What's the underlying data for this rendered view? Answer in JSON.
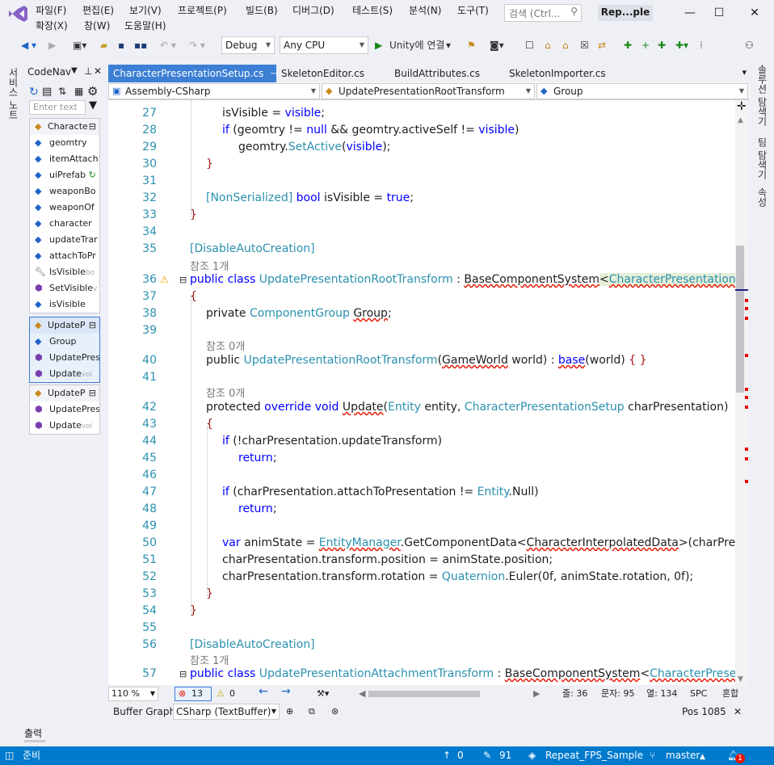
{
  "menu": {
    "items_row1": [
      "파일(F)",
      "편집(E)",
      "보기(V)",
      "프로젝트(P)",
      "빌드(B)",
      "디버그(D)",
      "테스트(S)",
      "분석(N)",
      "도구(T)"
    ],
    "items_row2": [
      "확장(X)",
      "창(W)",
      "도움말(H)"
    ],
    "search_placeholder": "검색 (Ctrl...",
    "solution_name": "Rep...ple"
  },
  "toolbar": {
    "config": "Debug",
    "platform": "Any CPU",
    "run_label": "Unity에 연결"
  },
  "left_side": {
    "label": "서비스 노트"
  },
  "codenav": {
    "title": "CodeNav",
    "filter_placeholder": "Enter text to",
    "group1": {
      "header": "Characte",
      "items": [
        "geomtry",
        "itemAttach",
        "uiPrefab",
        "weaponBo",
        "weaponOf",
        "character",
        "updateTrar",
        "attachToPr",
        "IsVisible",
        "SetVisible",
        "isVisible"
      ],
      "hints": {
        "IsVisible": "bo",
        "SetVisible": "v"
      }
    },
    "group2": {
      "header": "UpdateP",
      "items": [
        "Group",
        "UpdatePres",
        "Update"
      ],
      "hints": {
        "Update": "voi"
      }
    },
    "group3": {
      "header": "UpdateP",
      "items": [
        "UpdatePres",
        "Update"
      ],
      "hints": {
        "Update": "voi"
      }
    }
  },
  "tabs": [
    "CharacterPresentationSetup.cs",
    "SkeletonEditor.cs",
    "BuildAttributes.cs",
    "SkeletonImporter.cs"
  ],
  "navbar": {
    "project": "Assembly-CSharp",
    "type": "UpdatePresentationRootTransform",
    "member": "Group"
  },
  "editor": {
    "codelens": "참조 1개",
    "codelens_zero": "참조 0개"
  },
  "status": {
    "zoom": "110 %",
    "errors": "13",
    "warnings": "0",
    "line": "줄: 36",
    "col": "문자: 95",
    "col2": "열: 134",
    "spc": "SPC",
    "eol": "혼합"
  },
  "buffer": {
    "label": "Buffer Graph:",
    "value": "CSharp (TextBuffer)",
    "pos": "Pos 1085"
  },
  "output": {
    "label": "출력"
  },
  "bottom": {
    "ready": "준비",
    "up": "0",
    "edits": "91",
    "repo": "Repeat_FPS_Sample",
    "branch": "master",
    "notif": "1"
  },
  "right_side": {
    "labels": [
      "솔루션 탐색기",
      "팀 탐색기",
      "속성"
    ]
  }
}
